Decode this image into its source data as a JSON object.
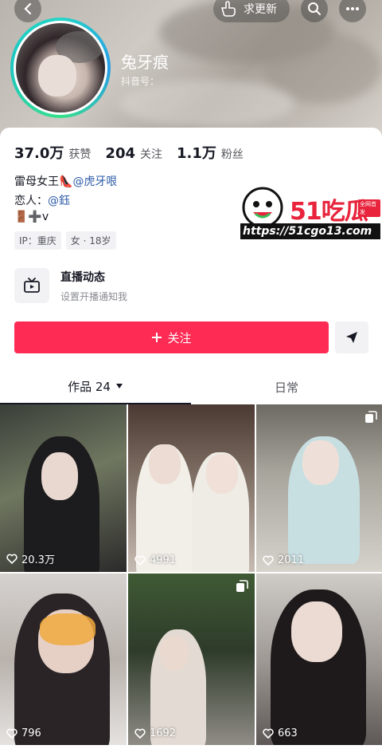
{
  "header": {
    "refresh_label": "求更新",
    "nickname": "兔牙痕",
    "douyin_id_label": "抖音号："
  },
  "stats": [
    {
      "value": "37.0万",
      "label": "获赞"
    },
    {
      "value": "204",
      "label": "关注"
    },
    {
      "value": "1.1万",
      "label": "粉丝"
    }
  ],
  "bio": {
    "line1_prefix": "雷母女王👠",
    "line1_mention": "@虎牙哏",
    "line2_prefix": "恋人：",
    "line2_mention": "@鈺",
    "line3": "🚪➕v"
  },
  "tags": [
    "IP：重庆",
    "女 · 18岁"
  ],
  "live": {
    "title": "直播动态",
    "subtitle": "设置开播通知我"
  },
  "actions": {
    "follow_label": "关注"
  },
  "tabs": {
    "works_label": "作品 24",
    "daily_label": "日常"
  },
  "videos": [
    {
      "likes": "20.3万",
      "multi": false
    },
    {
      "likes": "4991",
      "multi": false
    },
    {
      "likes": "2011",
      "multi": true
    },
    {
      "likes": "796",
      "multi": false
    },
    {
      "likes": "1692",
      "multi": true
    },
    {
      "likes": "663",
      "multi": false
    }
  ],
  "watermark": {
    "title": "51吃瓜",
    "badge": "全网首发",
    "url": "https://51cgo13.com"
  },
  "colors": {
    "accent": "#fe2c55",
    "mention": "#2c5ba8",
    "text": "#161823",
    "muted": "#57585f"
  }
}
